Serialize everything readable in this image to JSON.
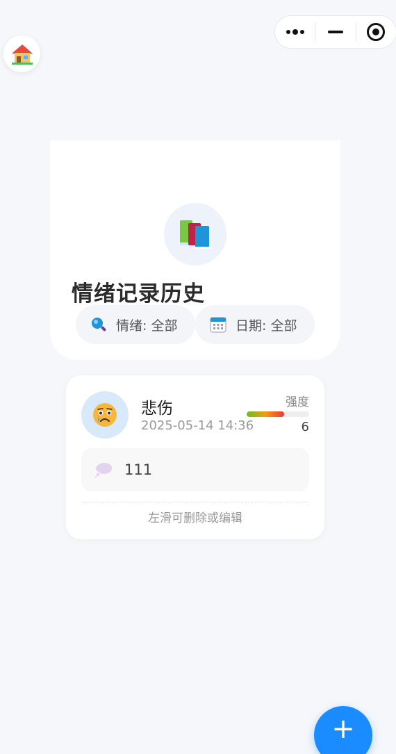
{
  "nav": {
    "home_icon": "house-icon"
  },
  "header": {
    "title": "情绪记录历史",
    "title_icon": "books-icon",
    "filters": [
      {
        "icon": "magnifier-icon",
        "label": "情绪: 全部"
      },
      {
        "icon": "calendar-icon",
        "label": "日期: 全部"
      }
    ]
  },
  "records": [
    {
      "emotion": "悲伤",
      "emoji_icon": "sad-face-icon",
      "datetime": "2025-05-14 14:36",
      "intensity_label": "强度",
      "intensity_value": "6",
      "intensity_fraction": 0.6,
      "note_icon": "thought-bubble-icon",
      "note": "111",
      "hint": "左滑可删除或编辑"
    }
  ],
  "fab": {
    "label": "+"
  },
  "colors": {
    "accent": "#1a8cff",
    "background": "#f6f7fa",
    "emotion_circle": "#d7e9fb"
  }
}
